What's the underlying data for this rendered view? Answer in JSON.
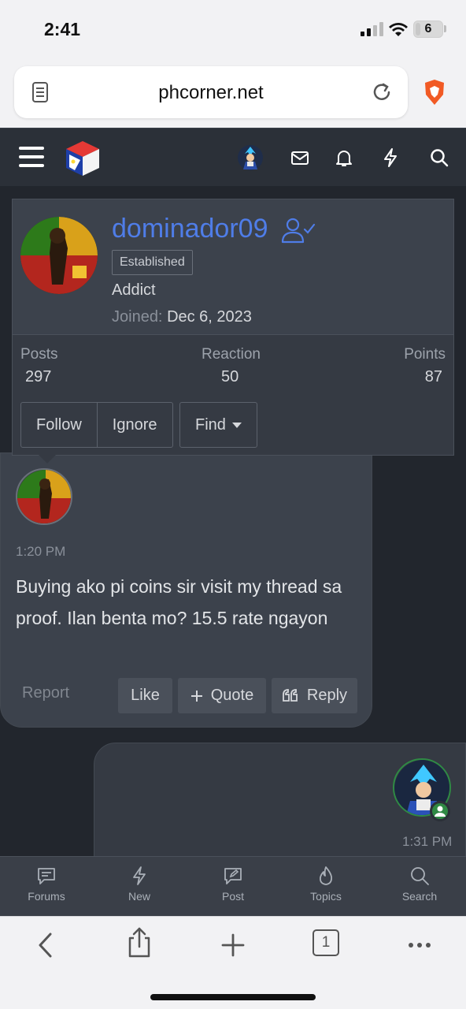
{
  "status_bar": {
    "time": "2:41",
    "battery": "6"
  },
  "browser": {
    "url": "phcorner.net"
  },
  "profile_popup": {
    "username": "dominador09",
    "badge": "Established",
    "user_title": "Addict",
    "joined_label": "Joined:",
    "joined_date": "Dec 6, 2023",
    "stats": [
      {
        "label": "Posts",
        "value": "297"
      },
      {
        "label": "Reaction",
        "value": "50"
      },
      {
        "label": "Points",
        "value": "87"
      }
    ],
    "buttons": {
      "follow": "Follow",
      "ignore": "Ignore",
      "find": "Find"
    }
  },
  "messages": [
    {
      "time": "1:20 PM",
      "text": "Buying ako pi coins sir visit my thread sa proof. Ilan benta mo? 15.5 rate ngayon",
      "actions": {
        "report": "Report",
        "like": "Like",
        "quote": "Quote",
        "reply": "Reply"
      }
    },
    {
      "time": "1:31 PM"
    }
  ],
  "tabbar": [
    {
      "label": "Forums",
      "icon": "forums-icon"
    },
    {
      "label": "New",
      "icon": "lightning-icon"
    },
    {
      "label": "Post",
      "icon": "post-icon"
    },
    {
      "label": "Topics",
      "icon": "fire-icon"
    },
    {
      "label": "Search",
      "icon": "search-icon"
    }
  ],
  "safari_toolbar": {
    "tabs_count": "1"
  },
  "colors": {
    "username": "#4f7de8",
    "online": "#2f8a44",
    "header_bg": "#2b3038"
  }
}
